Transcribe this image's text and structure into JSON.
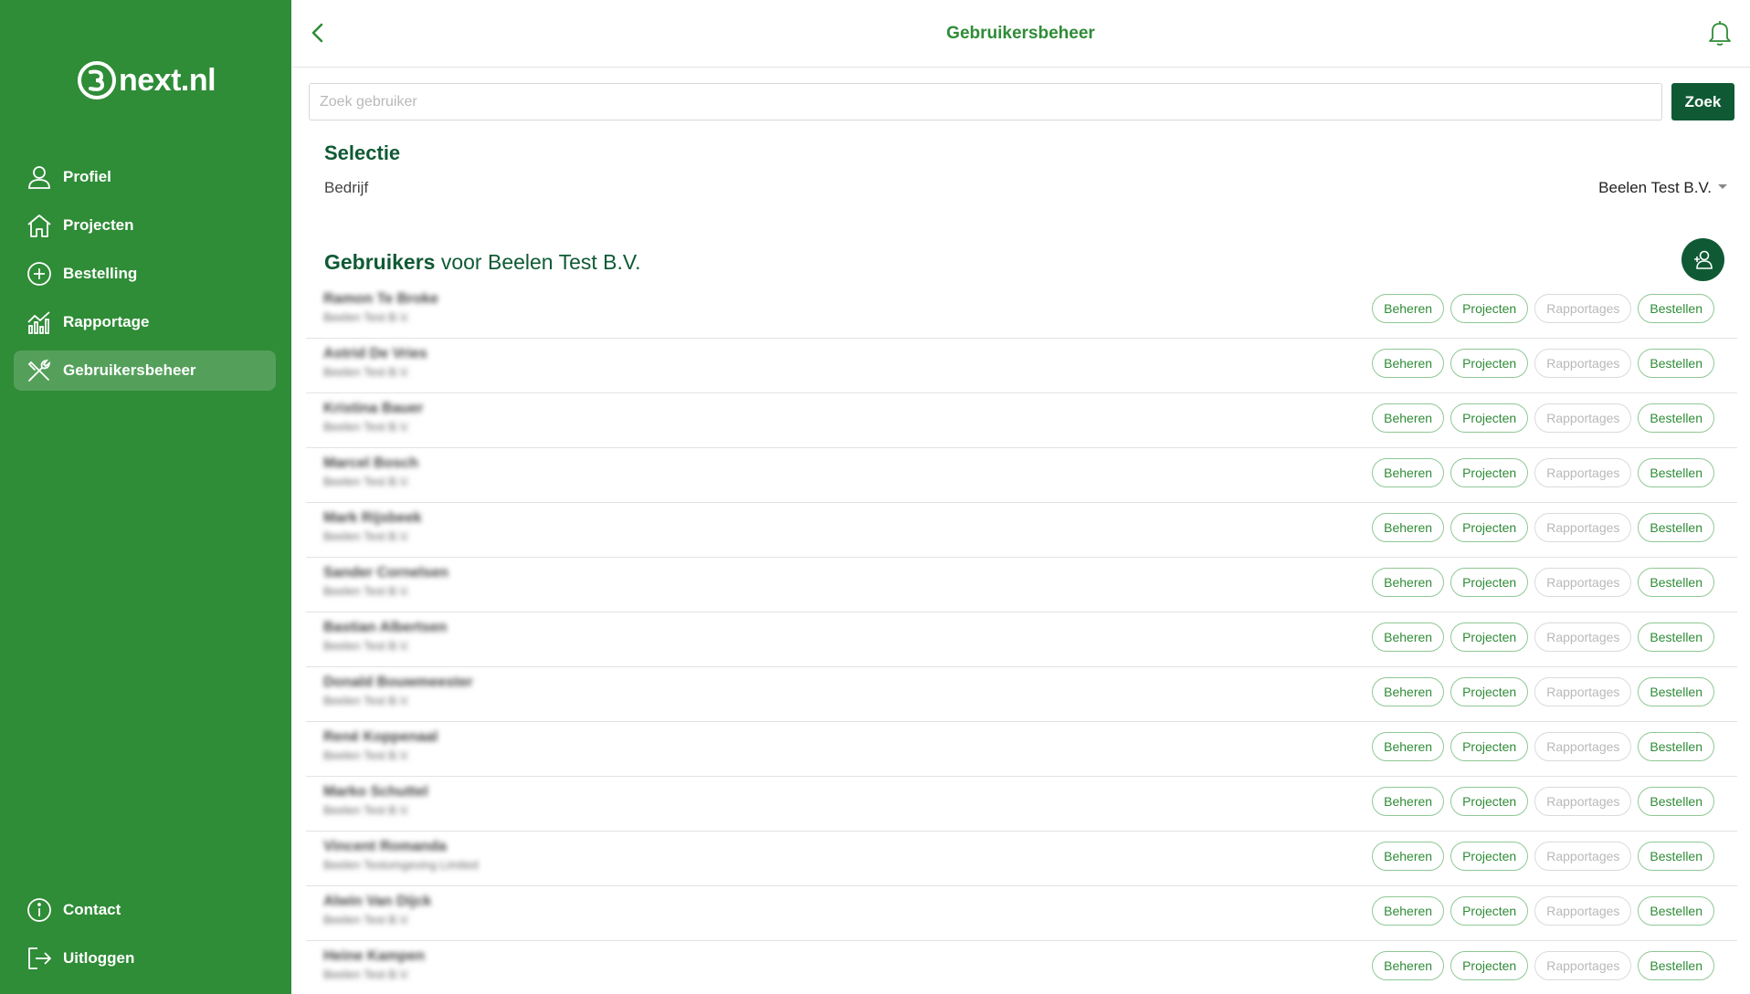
{
  "app": {
    "logo_text": "next.nl"
  },
  "sidebar": {
    "items": [
      {
        "label": "Profiel",
        "icon": "user-icon"
      },
      {
        "label": "Projecten",
        "icon": "home-icon"
      },
      {
        "label": "Bestelling",
        "icon": "plus-circle-icon"
      },
      {
        "label": "Rapportage",
        "icon": "chart-icon"
      },
      {
        "label": "Gebruikersbeheer",
        "icon": "tools-icon",
        "active": true
      }
    ],
    "bottom": [
      {
        "label": "Contact",
        "icon": "info-icon"
      },
      {
        "label": "Uitloggen",
        "icon": "logout-icon"
      }
    ]
  },
  "header": {
    "title": "Gebruikersbeheer"
  },
  "search": {
    "placeholder": "Zoek gebruiker",
    "value": "",
    "button_label": "Zoek"
  },
  "selection": {
    "title": "Selectie",
    "company_label": "Bedrijf",
    "company_value": "Beelen Test B.V."
  },
  "users": {
    "heading_bold": "Gebruikers",
    "heading_rest": " voor Beelen Test B.V.",
    "action_labels": [
      "Beheren",
      "Projecten",
      "Rapportages",
      "Bestellen"
    ],
    "rows": [
      {
        "name": "Ramon Te Broke",
        "company": "Beelen Test B.V."
      },
      {
        "name": "Astrid De Vries",
        "company": "Beelen Test B.V."
      },
      {
        "name": "Kristina Bauer",
        "company": "Beelen Test B.V."
      },
      {
        "name": "Marcel Bosch",
        "company": "Beelen Test B.V."
      },
      {
        "name": "Mark Rijsbeek",
        "company": "Beelen Test B.V."
      },
      {
        "name": "Sander Cornelsen",
        "company": "Beelen Test B.V."
      },
      {
        "name": "Bastian Albertsen",
        "company": "Beelen Test B.V."
      },
      {
        "name": "Donald Bouwmeester",
        "company": "Beelen Test B.V."
      },
      {
        "name": "René Koppenaal",
        "company": "Beelen Test B.V."
      },
      {
        "name": "Marko Schuttel",
        "company": "Beelen Test B.V."
      },
      {
        "name": "Vincent Romanda",
        "company": "Beelen Testomgeving Limited"
      },
      {
        "name": "Alwin Van Dijck",
        "company": "Beelen Test B.V."
      },
      {
        "name": "Heine Kampen",
        "company": "Beelen Test B.V."
      }
    ]
  },
  "colors": {
    "sidebar_bg": "#2f8c37",
    "primary_dark": "#0f5a34",
    "accent": "#2f8c37"
  }
}
